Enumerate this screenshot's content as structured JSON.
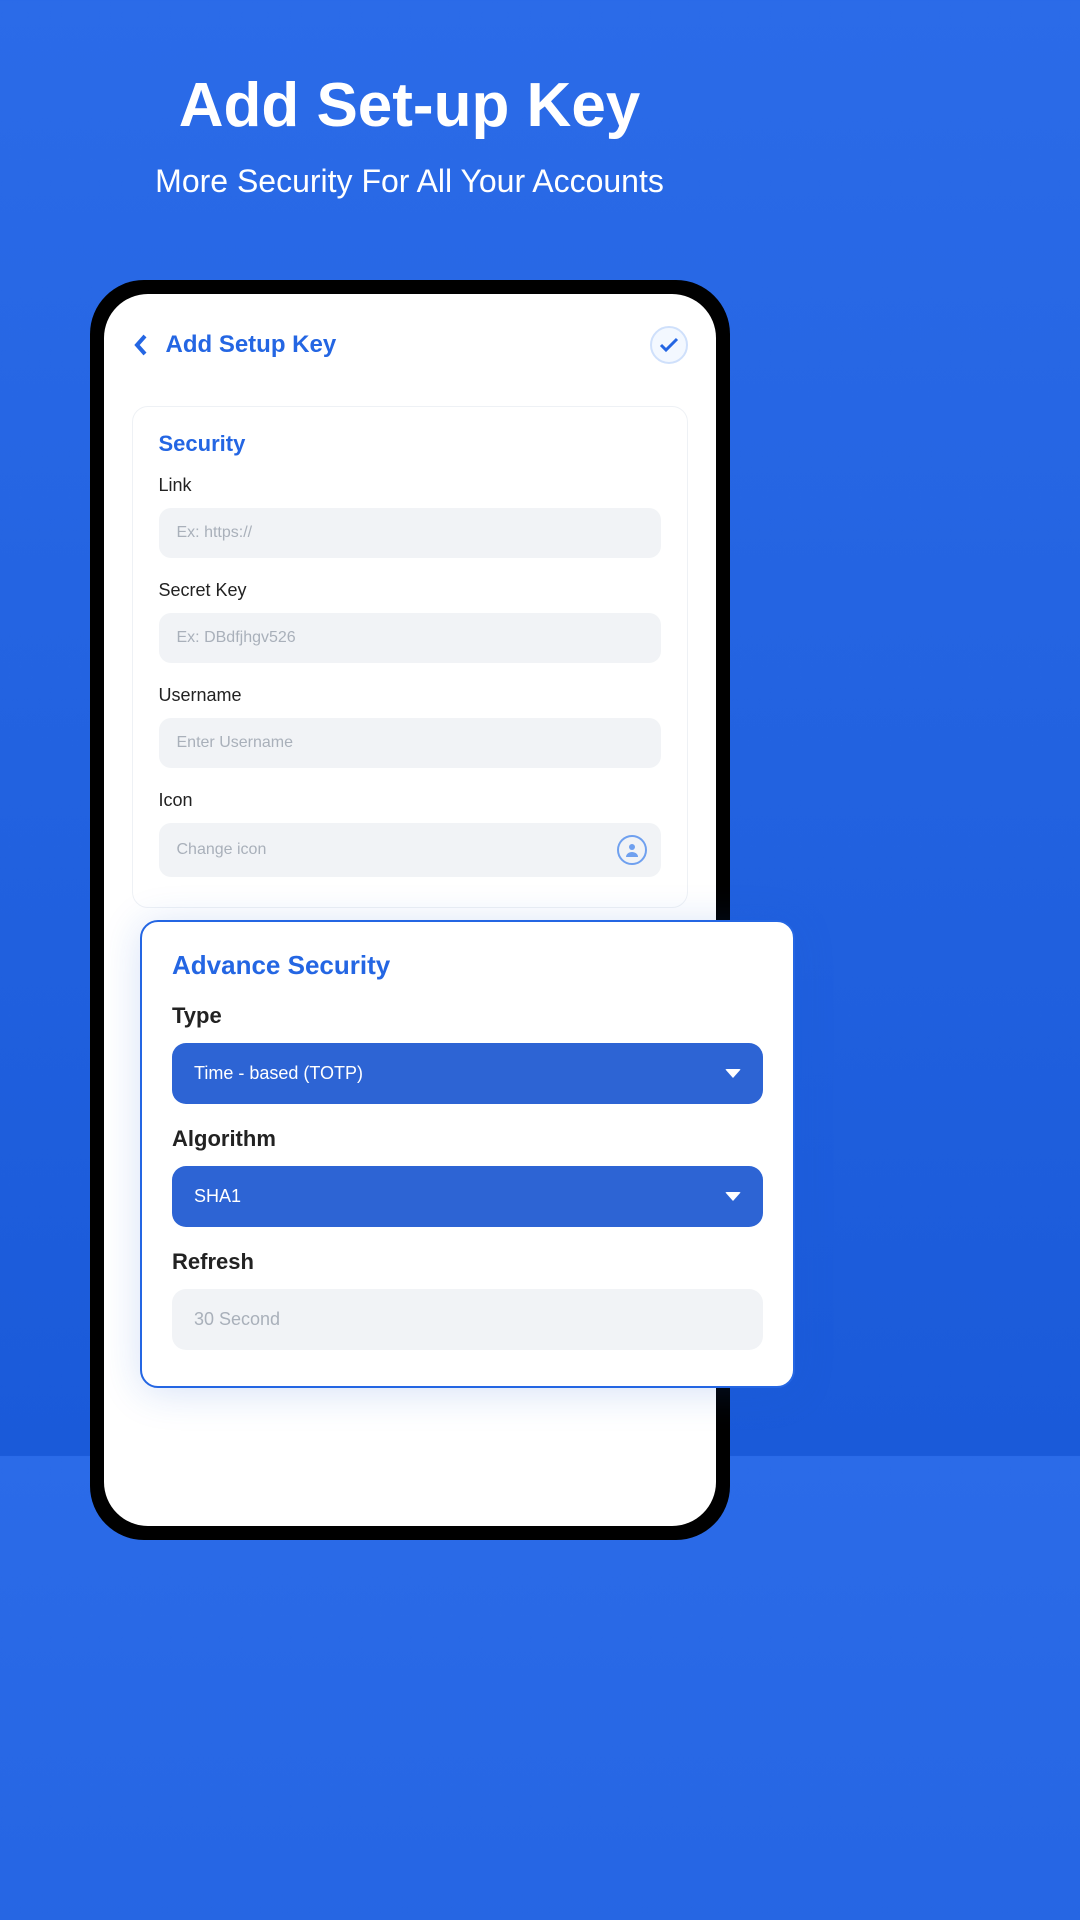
{
  "hero": {
    "title": "Add Set-up Key",
    "subtitle": "More Security For All Your Accounts"
  },
  "header": {
    "page_title": "Add Setup Key"
  },
  "security": {
    "card_title": "Security",
    "link_label": "Link",
    "link_placeholder": "Ex: https://",
    "secret_label": "Secret Key",
    "secret_placeholder": "Ex: DBdfjhgv526",
    "username_label": "Username",
    "username_placeholder": "Enter Username",
    "icon_label": "Icon",
    "icon_placeholder": "Change icon"
  },
  "advance": {
    "card_title": "Advance Security",
    "type_label": "Type",
    "type_value": "Time - based (TOTP)",
    "algorithm_label": "Algorithm",
    "algorithm_value": "SHA1",
    "refresh_label": "Refresh",
    "refresh_value": "30 Second"
  }
}
